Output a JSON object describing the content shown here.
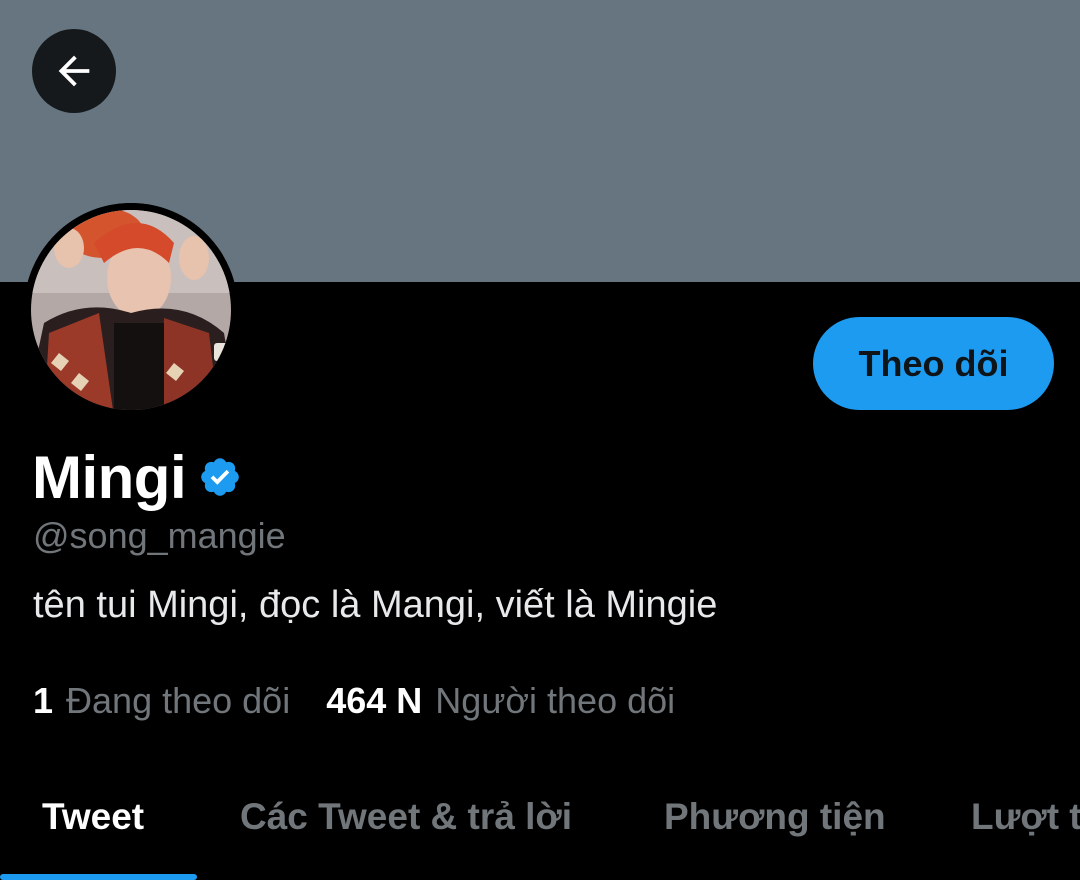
{
  "profile": {
    "display_name": "Mingi",
    "handle": "@song_mangie",
    "bio": "tên tui Mingi, đọc là Mangi, viết là Mingie",
    "verified": true,
    "follow_label": "Theo dõi"
  },
  "stats": {
    "following_count": "1",
    "following_label": "Đang theo dõi",
    "followers_count": "464 N",
    "followers_label": "Người theo dõi"
  },
  "tabs": [
    {
      "label": "Tweet",
      "active": true
    },
    {
      "label": "Các Tweet & trả lời",
      "active": false
    },
    {
      "label": "Phương tiện",
      "active": false
    },
    {
      "label": "Lượt thích",
      "active": false
    }
  ],
  "icons": {
    "back": "back-arrow-icon",
    "verified": "verified-badge-icon"
  },
  "colors": {
    "banner": "#66757f",
    "accent": "#1d9bf0",
    "background": "#000000",
    "secondary_text": "#71767b"
  }
}
